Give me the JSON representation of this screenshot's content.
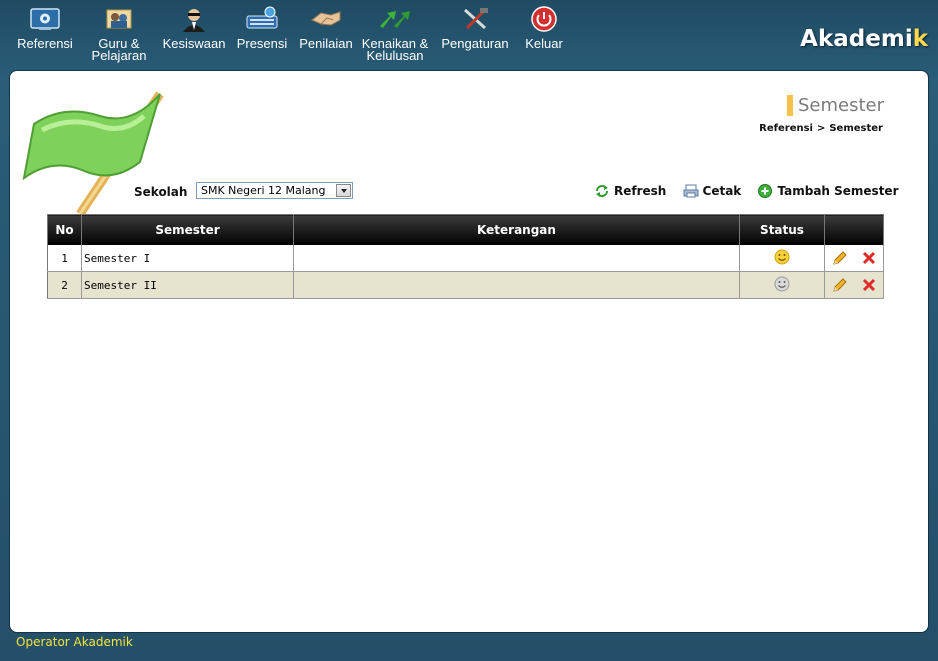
{
  "app": {
    "brand_main": "Akademi",
    "brand_accent": "k"
  },
  "nav": [
    {
      "label": "Referensi",
      "icon": "settings-monitor-icon"
    },
    {
      "label": "Guru &\nPelajaran",
      "icon": "teachers-icon"
    },
    {
      "label": "Kesiswaan",
      "icon": "student-icon"
    },
    {
      "label": "Presensi",
      "icon": "attendance-keyboard-icon"
    },
    {
      "label": "Penilaian",
      "icon": "handshake-icon"
    },
    {
      "label": "Kenaikan &\nKelulusan",
      "icon": "promotion-arrows-icon"
    },
    {
      "label": "Pengaturan",
      "icon": "tools-icon"
    },
    {
      "label": "Keluar",
      "icon": "power-icon"
    }
  ],
  "page": {
    "title": "Semester",
    "breadcrumb": {
      "parent": "Referensi",
      "separator": ">",
      "current": "Semester"
    }
  },
  "filter": {
    "label": "Sekolah",
    "selected": "SMK Negeri 12 Malang"
  },
  "actions": {
    "refresh": "Refresh",
    "print": "Cetak",
    "add": "Tambah Semester"
  },
  "table": {
    "headers": {
      "no": "No",
      "semester": "Semester",
      "keterangan": "Keterangan",
      "status": "Status"
    },
    "rows": [
      {
        "no": "1",
        "semester": "Semester I",
        "keterangan": "",
        "status": "active"
      },
      {
        "no": "2",
        "semester": "Semester II",
        "keterangan": "",
        "status": "inactive"
      }
    ]
  },
  "footer": {
    "user": "Operator Akademik"
  },
  "colors": {
    "accent": "#f7c04a",
    "frame": "#2a5d78",
    "footer_text": "#f4e33c",
    "row_alt": "#e6e3cf"
  }
}
